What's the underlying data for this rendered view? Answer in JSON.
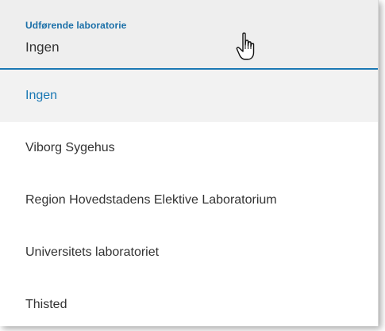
{
  "select": {
    "label": "Udførende laboratorie",
    "value": "Ingen"
  },
  "options": [
    {
      "label": "Ingen",
      "selected": true
    },
    {
      "label": "Viborg Sygehus",
      "selected": false
    },
    {
      "label": "Region Hovedstadens Elektive Laboratorium",
      "selected": false
    },
    {
      "label": "Universitets laboratoriet",
      "selected": false
    },
    {
      "label": "Thisted",
      "selected": false
    }
  ],
  "icons": {
    "cursor": "hand-pointer-icon"
  },
  "colors": {
    "accent": "#1a78b4",
    "field_background": "#eeeeee",
    "selected_background": "#f2f2f2",
    "text": "#333333"
  }
}
